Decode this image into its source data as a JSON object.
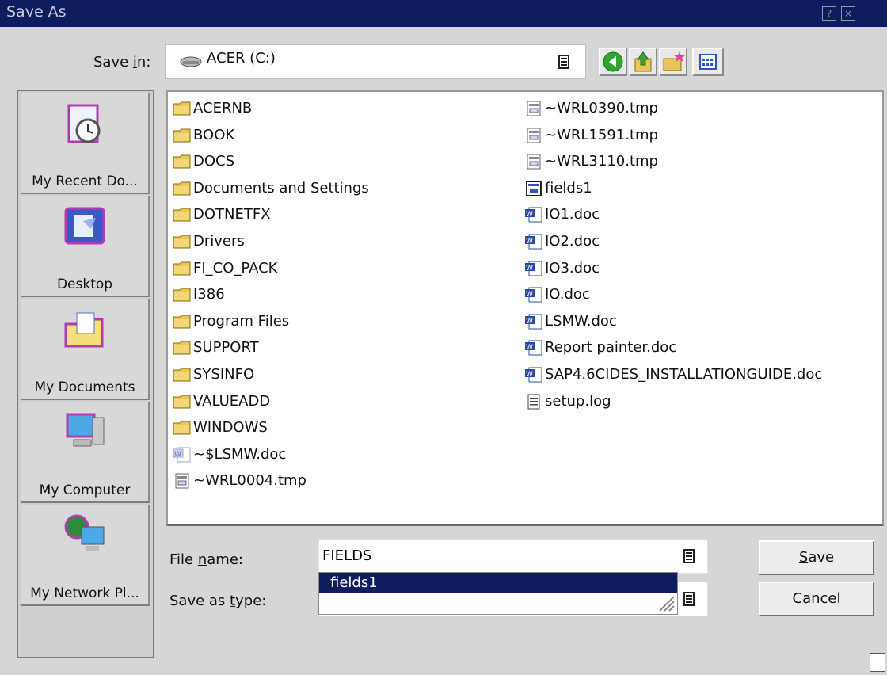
{
  "window": {
    "title": "Save As",
    "help_glyph": "?",
    "close_glyph": "×"
  },
  "save_in": {
    "label_pre": "Save ",
    "label_key": "i",
    "label_post": "n:",
    "value": "ACER (C:)",
    "icon": "drive-icon"
  },
  "toolbar": [
    {
      "name": "back-button",
      "icon": "back-arrow-icon"
    },
    {
      "name": "up-folder-button",
      "icon": "up-folder-icon"
    },
    {
      "name": "new-folder-button",
      "icon": "new-folder-icon"
    },
    {
      "name": "view-menu-button",
      "icon": "view-menu-icon"
    }
  ],
  "places": [
    {
      "label": "My Recent Do...",
      "icon": "recent-documents-icon"
    },
    {
      "label": "Desktop",
      "icon": "desktop-icon"
    },
    {
      "label": "My Documents",
      "icon": "my-documents-icon"
    },
    {
      "label": "My Computer",
      "icon": "my-computer-icon"
    },
    {
      "label": "My Network Pl...",
      "icon": "my-network-places-icon"
    }
  ],
  "files_col1": [
    {
      "name": "ACERNB",
      "type": "folder"
    },
    {
      "name": "BOOK",
      "type": "folder"
    },
    {
      "name": "DOCS",
      "type": "folder"
    },
    {
      "name": "Documents and Settings",
      "type": "folder"
    },
    {
      "name": "DOTNETFX",
      "type": "folder"
    },
    {
      "name": "Drivers",
      "type": "folder"
    },
    {
      "name": "FI_CO_PACK",
      "type": "folder"
    },
    {
      "name": "I386",
      "type": "folder"
    },
    {
      "name": "Program Files",
      "type": "folder"
    },
    {
      "name": "SUPPORT",
      "type": "folder"
    },
    {
      "name": "SYSINFO",
      "type": "folder"
    },
    {
      "name": "VALUEADD",
      "type": "folder"
    },
    {
      "name": "WINDOWS",
      "type": "folder"
    },
    {
      "name": "~$LSMW.doc",
      "type": "doc-faded"
    },
    {
      "name": "~WRL0004.tmp",
      "type": "tmp"
    }
  ],
  "files_col2": [
    {
      "name": "~WRL0390.tmp",
      "type": "tmp"
    },
    {
      "name": "~WRL1591.tmp",
      "type": "tmp"
    },
    {
      "name": "~WRL3110.tmp",
      "type": "tmp"
    },
    {
      "name": "fields1",
      "type": "form"
    },
    {
      "name": "IO1.doc",
      "type": "doc"
    },
    {
      "name": "IO2.doc",
      "type": "doc"
    },
    {
      "name": "IO3.doc",
      "type": "doc"
    },
    {
      "name": "IO.doc",
      "type": "doc"
    },
    {
      "name": "LSMW.doc",
      "type": "doc"
    },
    {
      "name": "Report painter.doc",
      "type": "doc"
    },
    {
      "name": "SAP4.6CIDES_INSTALLATIONGUIDE.doc",
      "type": "doc"
    },
    {
      "name": "setup.log",
      "type": "log"
    }
  ],
  "file_name": {
    "label_pre": "File ",
    "label_key": "n",
    "label_post": "ame:",
    "value": "FIELDS"
  },
  "save_as_type": {
    "label_pre": "Save as ",
    "label_key": "t",
    "label_post": "ype:",
    "value": ""
  },
  "autocomplete": {
    "options": [
      "fields1"
    ]
  },
  "buttons": {
    "save_key": "S",
    "save_rest": "ave",
    "cancel": "Cancel"
  },
  "colors": {
    "title_bar": "#0f1c5e",
    "selection": "#0f1c5e",
    "folder": "#e9c65a"
  }
}
